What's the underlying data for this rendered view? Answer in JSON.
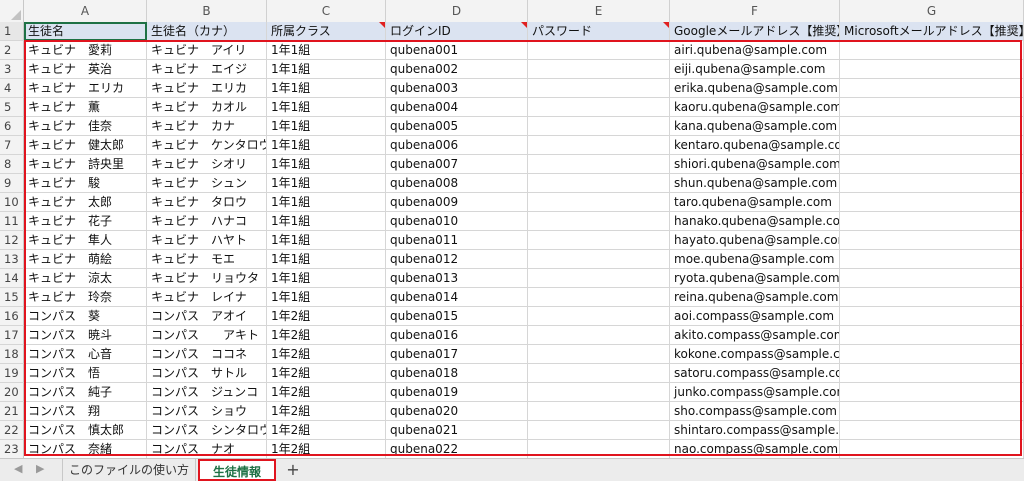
{
  "columns": [
    "A",
    "B",
    "C",
    "D",
    "E",
    "F",
    "G"
  ],
  "header_row": {
    "num": "1",
    "cells": [
      "生徒名",
      "生徒名（カナ）",
      "所属クラス",
      "ログインID",
      "パスワード",
      "Googleメールアドレス【推奨】",
      "Microsoftメールアドレス【推奨】"
    ]
  },
  "rows": [
    {
      "num": "2",
      "cells": [
        "キュビナ　愛莉",
        "キュビナ　アイリ",
        "1年1組",
        "qubena001",
        "",
        "airi.qubena@sample.com",
        ""
      ]
    },
    {
      "num": "3",
      "cells": [
        "キュビナ　英治",
        "キュビナ　エイジ",
        "1年1組",
        "qubena002",
        "",
        "eiji.qubena@sample.com",
        ""
      ]
    },
    {
      "num": "4",
      "cells": [
        "キュビナ　エリカ",
        "キュビナ　エリカ",
        "1年1組",
        "qubena003",
        "",
        "erika.qubena@sample.com",
        ""
      ]
    },
    {
      "num": "5",
      "cells": [
        "キュビナ　薫",
        "キュビナ　カオル",
        "1年1組",
        "qubena004",
        "",
        "kaoru.qubena@sample.com",
        ""
      ]
    },
    {
      "num": "6",
      "cells": [
        "キュビナ　佳奈",
        "キュビナ　カナ",
        "1年1組",
        "qubena005",
        "",
        "kana.qubena@sample.com",
        ""
      ]
    },
    {
      "num": "7",
      "cells": [
        "キュビナ　健太郎",
        "キュビナ　ケンタロウ",
        "1年1組",
        "qubena006",
        "",
        "kentaro.qubena@sample.com",
        ""
      ]
    },
    {
      "num": "8",
      "cells": [
        "キュビナ　詩央里",
        "キュビナ　シオリ",
        "1年1組",
        "qubena007",
        "",
        "shiori.qubena@sample.com",
        ""
      ]
    },
    {
      "num": "9",
      "cells": [
        "キュビナ　駿",
        "キュビナ　シュン",
        "1年1組",
        "qubena008",
        "",
        "shun.qubena@sample.com",
        ""
      ]
    },
    {
      "num": "10",
      "cells": [
        "キュビナ　太郎",
        "キュビナ　タロウ",
        "1年1組",
        "qubena009",
        "",
        "taro.qubena@sample.com",
        ""
      ]
    },
    {
      "num": "11",
      "cells": [
        "キュビナ　花子",
        "キュビナ　ハナコ",
        "1年1組",
        "qubena010",
        "",
        "hanako.qubena@sample.com",
        ""
      ]
    },
    {
      "num": "12",
      "cells": [
        "キュビナ　隼人",
        "キュビナ　ハヤト",
        "1年1組",
        "qubena011",
        "",
        "hayato.qubena@sample.com",
        ""
      ]
    },
    {
      "num": "13",
      "cells": [
        "キュビナ　萌絵",
        "キュビナ　モエ",
        "1年1組",
        "qubena012",
        "",
        "moe.qubena@sample.com",
        ""
      ]
    },
    {
      "num": "14",
      "cells": [
        "キュビナ　涼太",
        "キュビナ　リョウタ",
        "1年1組",
        "qubena013",
        "",
        "ryota.qubena@sample.com",
        ""
      ]
    },
    {
      "num": "15",
      "cells": [
        "キュビナ　玲奈",
        "キュビナ　レイナ",
        "1年1組",
        "qubena014",
        "",
        "reina.qubena@sample.com",
        ""
      ]
    },
    {
      "num": "16",
      "cells": [
        "コンパス　葵",
        "コンパス　アオイ",
        "1年2組",
        "qubena015",
        "",
        "aoi.compass@sample.com",
        ""
      ]
    },
    {
      "num": "17",
      "cells": [
        "コンパス　暁斗",
        "コンパス　　アキト",
        "1年2組",
        "qubena016",
        "",
        "akito.compass@sample.com",
        ""
      ]
    },
    {
      "num": "18",
      "cells": [
        "コンパス　心音",
        "コンパス　ココネ",
        "1年2組",
        "qubena017",
        "",
        "kokone.compass@sample.com",
        ""
      ]
    },
    {
      "num": "19",
      "cells": [
        "コンパス　悟",
        "コンパス　サトル",
        "1年2組",
        "qubena018",
        "",
        "satoru.compass@sample.com",
        ""
      ]
    },
    {
      "num": "20",
      "cells": [
        "コンパス　純子",
        "コンパス　ジュンコ",
        "1年2組",
        "qubena019",
        "",
        "junko.compass@sample.com",
        ""
      ]
    },
    {
      "num": "21",
      "cells": [
        "コンパス　翔",
        "コンパス　ショウ",
        "1年2組",
        "qubena020",
        "",
        "sho.compass@sample.com",
        ""
      ]
    },
    {
      "num": "22",
      "cells": [
        "コンパス　慎太郎",
        "コンパス　シンタロウ",
        "1年2組",
        "qubena021",
        "",
        "shintaro.compass@sample.com",
        ""
      ]
    },
    {
      "num": "23",
      "cells": [
        "コンパス　奈緒",
        "コンパス　ナオ",
        "1年2組",
        "qubena022",
        "",
        "nao.compass@sample.com",
        ""
      ]
    }
  ],
  "tabs": {
    "prev_icon": "◀",
    "next_icon": "▶",
    "sheet1": "このファイルの使い方",
    "sheet2": "生徒情報",
    "add": "+"
  },
  "colors": {
    "accent_green": "#1e7145",
    "highlight_red": "#e0141e",
    "header_fill": "#dbe3f1"
  }
}
